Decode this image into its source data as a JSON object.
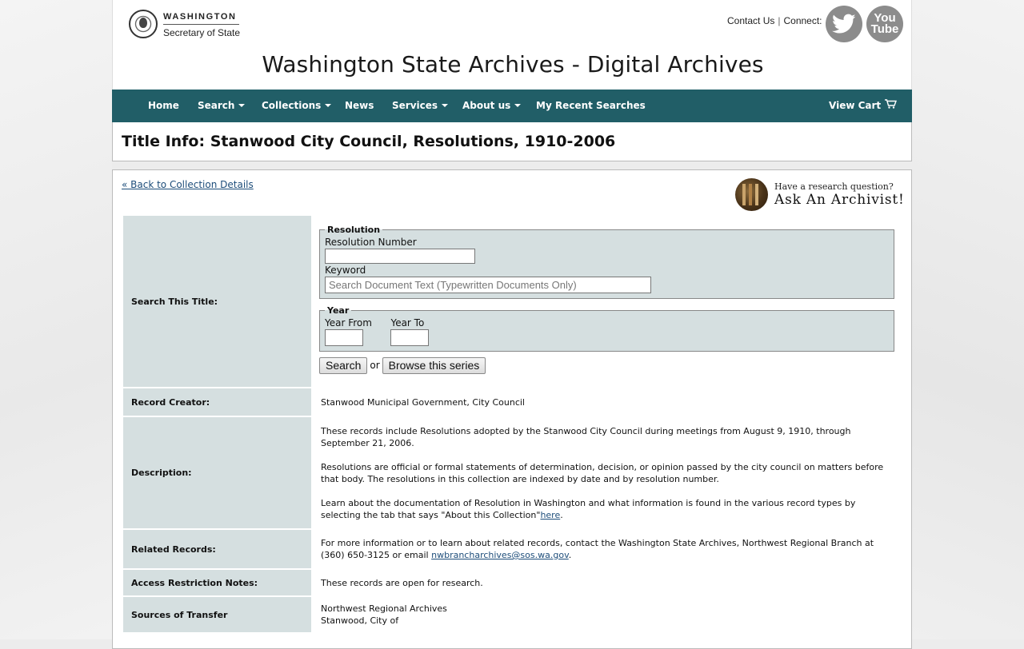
{
  "header": {
    "logo_line1": "WASHINGTON",
    "logo_line2": "Secretary of State",
    "contact_label": "Contact Us",
    "separator": "|",
    "connect_label": "Connect:",
    "youtube_label_1": "You",
    "youtube_label_2": "Tube",
    "site_title": "Washington State Archives - Digital Archives"
  },
  "nav": {
    "items": [
      {
        "label": "Home"
      },
      {
        "label": "Search"
      },
      {
        "label": "Collections"
      },
      {
        "label": "News"
      },
      {
        "label": "Services"
      },
      {
        "label": "About us"
      },
      {
        "label": "My Recent Searches"
      }
    ],
    "cart_label": "View Cart"
  },
  "page": {
    "title": "Title Info: Stanwood City Council, Resolutions, 1910-2006",
    "back_link": "« Back to Collection Details",
    "archivist_question": "Have a research question?",
    "archivist_cta": "Ask An Archivist!"
  },
  "search_form": {
    "row_label": "Search This Title:",
    "resolution_legend": "Resolution",
    "resolution_number_label": "Resolution Number",
    "resolution_number_value": "",
    "keyword_label": "Keyword",
    "keyword_placeholder": "Search Document Text (Typewritten Documents Only)",
    "year_legend": "Year",
    "year_from_label": "Year From",
    "year_to_label": "Year To",
    "search_button": "Search",
    "or_text": "or",
    "browse_button": "Browse this series"
  },
  "rows": {
    "record_creator": {
      "label": "Record Creator:",
      "value": "Stanwood Municipal Government, City Council"
    },
    "description": {
      "label": "Description:",
      "p1": "These records include Resolutions adopted by the Stanwood City Council during meetings from August 9, 1910, through September 21, 2006.",
      "p2": "Resolutions are official or formal statements of determination, decision, or opinion passed by the city council on matters before that body. The resolutions in this collection are indexed by date and by resolution number.",
      "p3_text": "Learn about the documentation of Resolution in Washington and what information is found in the various record types by selecting the tab that says \"About this Collection\"",
      "p3_link": "here",
      "p3_end": "."
    },
    "related_records": {
      "label": "Related Records:",
      "text": "For more information or to learn about related records, contact the Washington State Archives, Northwest Regional Branch at (360) 650-3125 or email ",
      "email": "nwbrancharchives@sos.wa.gov",
      "end": "."
    },
    "access_restriction": {
      "label": "Access Restriction Notes:",
      "value": "These records are open for research."
    },
    "sources_of_transfer": {
      "label": "Sources of Transfer",
      "line1": "Northwest Regional Archives",
      "line2": "Stanwood, City of"
    }
  },
  "colors": {
    "nav_bg": "#215e67",
    "label_cell_bg": "#d5dfe0",
    "link": "#1d4d7a"
  }
}
